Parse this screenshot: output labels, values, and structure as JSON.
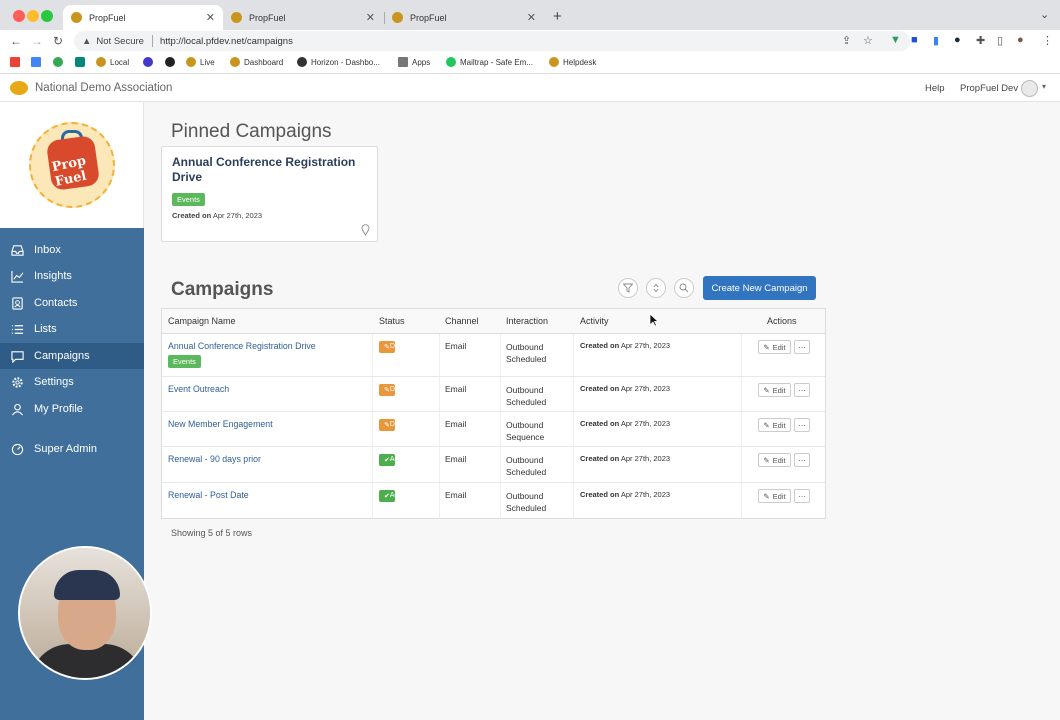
{
  "browser": {
    "tabs": [
      {
        "title": "PropFuel",
        "active": true
      },
      {
        "title": "PropFuel",
        "active": false
      },
      {
        "title": "PropFuel",
        "active": false
      }
    ],
    "security": "Not Secure",
    "url": "http://local.pfdev.net/campaigns",
    "bookmarks": [
      "Local",
      "Live",
      "Dashboard",
      "Horizon - Dashbo...",
      "Apps",
      "Mailtrap - Safe Em...",
      "Helpdesk"
    ]
  },
  "appbar": {
    "org_name": "National Demo Association",
    "help": "Help",
    "user_name": "PropFuel Dev"
  },
  "sidebar": {
    "logo_text": "Prop Fuel",
    "items": [
      {
        "label": "Inbox",
        "icon": "inbox-icon"
      },
      {
        "label": "Insights",
        "icon": "chart-icon"
      },
      {
        "label": "Contacts",
        "icon": "contacts-icon"
      },
      {
        "label": "Lists",
        "icon": "list-icon"
      },
      {
        "label": "Campaigns",
        "icon": "chat-icon",
        "active": true
      },
      {
        "label": "Settings",
        "icon": "gear-icon"
      },
      {
        "label": "My Profile",
        "icon": "user-icon"
      },
      {
        "label": "Super Admin",
        "icon": "dashboard-icon"
      }
    ]
  },
  "pinned": {
    "heading": "Pinned Campaigns",
    "card": {
      "title": "Annual Conference Registration Drive",
      "badge": "Events",
      "created_label": "Created on",
      "created_date": "Apr 27th, 2023"
    }
  },
  "campaigns": {
    "heading": "Campaigns",
    "create_label": "Create New Campaign",
    "columns": [
      "Campaign Name",
      "Status",
      "Channel",
      "Interaction",
      "Activity",
      "Actions"
    ],
    "rows": [
      {
        "name": "Annual Conference Registration Drive",
        "badge": "Events",
        "status": "Draft",
        "channel": "Email",
        "interaction1": "Outbound",
        "interaction2": "Scheduled",
        "created_label": "Created on",
        "created_date": "Apr 27th, 2023"
      },
      {
        "name": "Event Outreach",
        "badge": "",
        "status": "Draft",
        "channel": "Email",
        "interaction1": "Outbound",
        "interaction2": "Scheduled",
        "created_label": "Created on",
        "created_date": "Apr 27th, 2023"
      },
      {
        "name": "New Member Engagement",
        "badge": "",
        "status": "Draft",
        "channel": "Email",
        "interaction1": "Outbound",
        "interaction2": "Sequence",
        "created_label": "Created on",
        "created_date": "Apr 27th, 2023"
      },
      {
        "name": "Renewal - 90 days prior",
        "badge": "",
        "status": "Active",
        "channel": "Email",
        "interaction1": "Outbound",
        "interaction2": "Scheduled",
        "created_label": "Created on",
        "created_date": "Apr 27th, 2023"
      },
      {
        "name": "Renewal - Post Date",
        "badge": "",
        "status": "Active",
        "channel": "Email",
        "interaction1": "Outbound",
        "interaction2": "Scheduled",
        "created_label": "Created on",
        "created_date": "Apr 27th, 2023"
      }
    ],
    "edit_label": "Edit",
    "more_label": "···",
    "showing": "Showing 5 of 5 rows"
  },
  "colors": {
    "sidebar": "#3f6f9a",
    "primary": "#3174c0",
    "draft": "#e8973a",
    "active": "#4cae4c",
    "events": "#5cb85c"
  }
}
